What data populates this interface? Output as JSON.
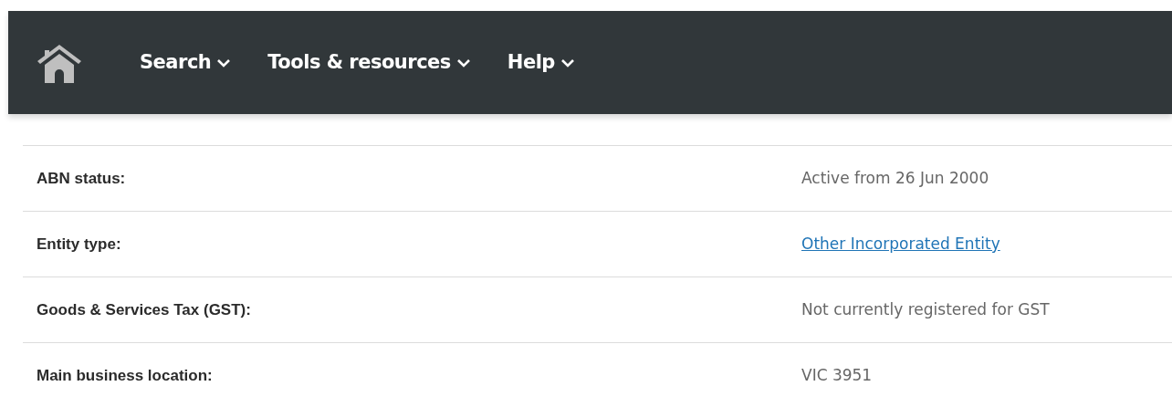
{
  "nav": {
    "items": [
      {
        "label": "Search"
      },
      {
        "label": "Tools & resources"
      },
      {
        "label": "Help"
      }
    ]
  },
  "details": [
    {
      "label": "ABN status:",
      "value": "Active from 26 Jun 2000",
      "kind": "text"
    },
    {
      "label": "Entity type:",
      "value": "Other Incorporated Entity",
      "kind": "link"
    },
    {
      "label": "Goods & Services Tax (GST):",
      "value": "Not currently registered for GST",
      "kind": "text"
    },
    {
      "label": "Main business location:",
      "value": "VIC 3951",
      "kind": "text"
    }
  ]
}
